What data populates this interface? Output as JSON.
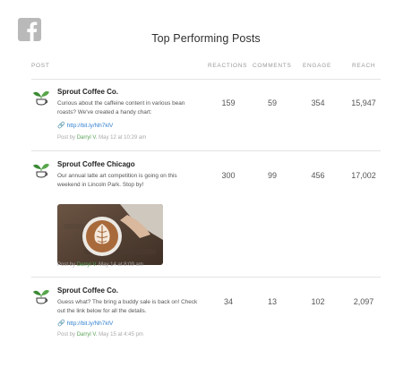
{
  "header": {
    "title": "Top Performing Posts",
    "logo_icon": "facebook-icon"
  },
  "columns": {
    "post": "POST",
    "reactions": "REACTIONS",
    "comments": "COMMENTS",
    "engage": "ENGAGE",
    "reach": "REACH"
  },
  "posts": [
    {
      "author": "Sprout Coffee Co.",
      "message": "Curious about the caffeine content in various bean roasts? We've created a handy chart:",
      "link": "http://bit.ly/Nh7klV",
      "meta_prefix": "Post by",
      "posted_by": "Darryl V.",
      "date": "May 12 at 10:29 am",
      "reactions": "159",
      "comments": "59",
      "engage": "354",
      "reach": "15,947"
    },
    {
      "author": "Sprout Coffee Chicago",
      "message": "Our annual latte art competition is going on this weekend in Lincoln Park. Stop by!",
      "meta_prefix": "Post by",
      "posted_by": "Darryl V.",
      "date": "May 14 at 8:09 am",
      "reactions": "300",
      "comments": "99",
      "engage": "456",
      "reach": "17,002"
    },
    {
      "author": "Sprout Coffee Co.",
      "message": "Guess what? The bring a buddy sale is back on! Check out the link below for all the details.",
      "link": "http://bit.ly/Nh7klV",
      "meta_prefix": "Post by",
      "posted_by": "Darryl V.",
      "date": "May 15 at 4:45 pm",
      "reactions": "34",
      "comments": "13",
      "engage": "102",
      "reach": "2,097"
    }
  ],
  "colors": {
    "link": "#2f7fd0",
    "author_meta": "#5aa35a",
    "logo": "#b9b9b9"
  }
}
